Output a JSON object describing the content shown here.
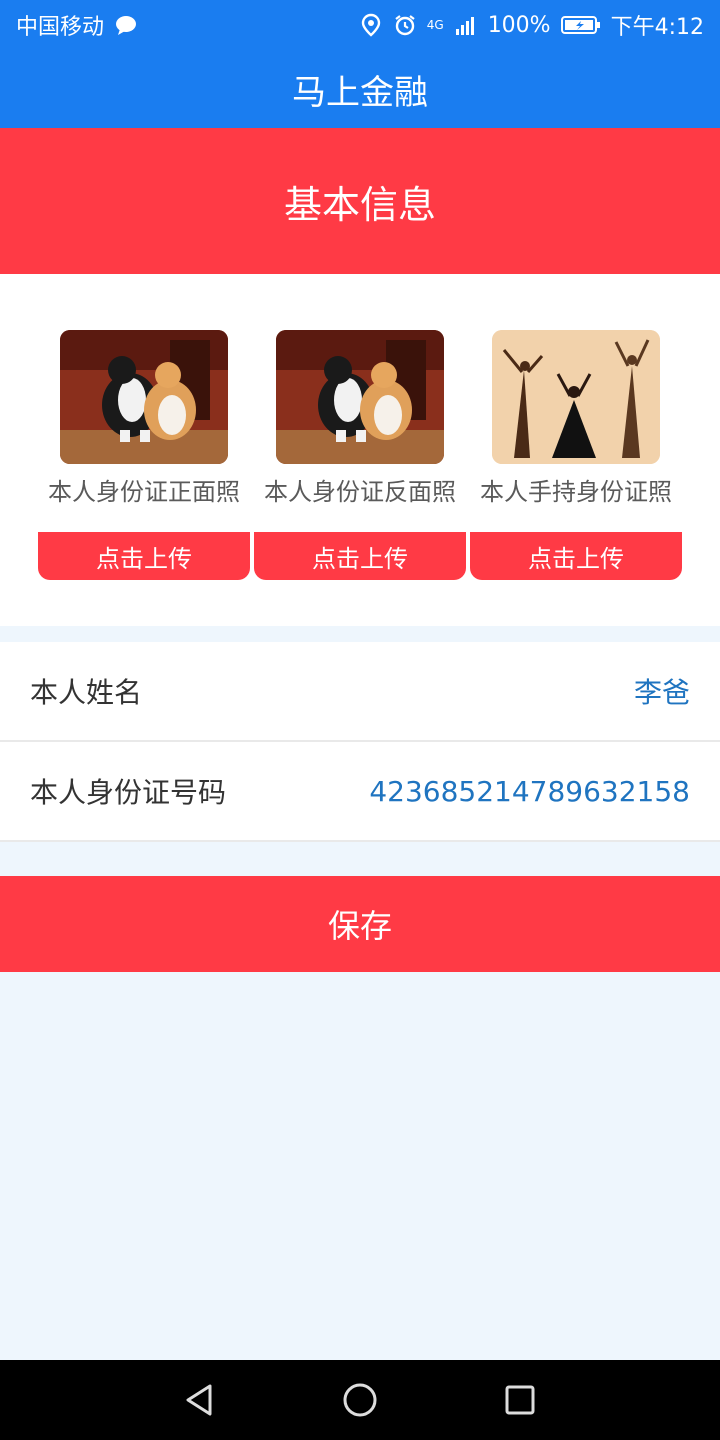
{
  "status_bar": {
    "carrier": "中国移动",
    "network": "4G",
    "battery": "100%",
    "time": "下午4:12"
  },
  "app": {
    "title": "马上金融"
  },
  "section": {
    "title": "基本信息"
  },
  "uploads": [
    {
      "label": "本人身份证正面照",
      "button": "点击上传",
      "image": "cat-photo"
    },
    {
      "label": "本人身份证反面照",
      "button": "点击上传",
      "image": "cat-photo"
    },
    {
      "label": "本人手持身份证照",
      "button": "点击上传",
      "image": "dancers-illustration"
    }
  ],
  "form": {
    "name_label": "本人姓名",
    "name_value": "李爸",
    "id_label": "本人身份证号码",
    "id_value": "423685214789632158"
  },
  "save_button": "保存",
  "colors": {
    "app_blue": "#1a7df0",
    "accent_red": "#ff3a45",
    "value_blue": "#1f74c0",
    "page_bg": "#eef6fd"
  },
  "nav": {
    "icons": [
      "back-icon",
      "home-icon",
      "recents-icon"
    ]
  }
}
